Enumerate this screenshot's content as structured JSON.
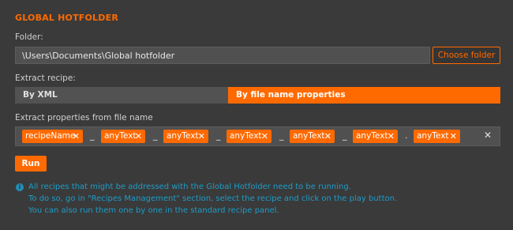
{
  "title": "GLOBAL HOTFOLDER",
  "folder": {
    "label": "Folder:",
    "value": "\\Users\\Documents\\Global hotfolder",
    "choose_label": "Choose folder"
  },
  "extract_recipe": {
    "label": "Extract recipe:",
    "options": [
      "By XML",
      "By file name properties"
    ],
    "selected": "By file name properties"
  },
  "extract_props": {
    "label": "Extract properties from file name",
    "chips": [
      "recipeName",
      "anyText",
      "anyText",
      "anyText",
      "anyText",
      "anyText",
      "anyText"
    ],
    "separators": [
      "_",
      "_",
      "_",
      "_",
      "_",
      "."
    ],
    "chip_remove_glyph": "✕",
    "clear_glyph": "✕"
  },
  "run_label": "Run",
  "info": {
    "icon": "info-icon",
    "lines": [
      "All recipes that might be addressed with the Global Hotfolder need to be running.",
      "To do so, go in \"Recipes Management\" section, select the recipe and click on the play button.",
      "You can also run them one by one in the standard recipe panel."
    ]
  },
  "colors": {
    "accent": "#ff6a00",
    "background": "#3a3a3a",
    "info": "#1e9cc7"
  }
}
